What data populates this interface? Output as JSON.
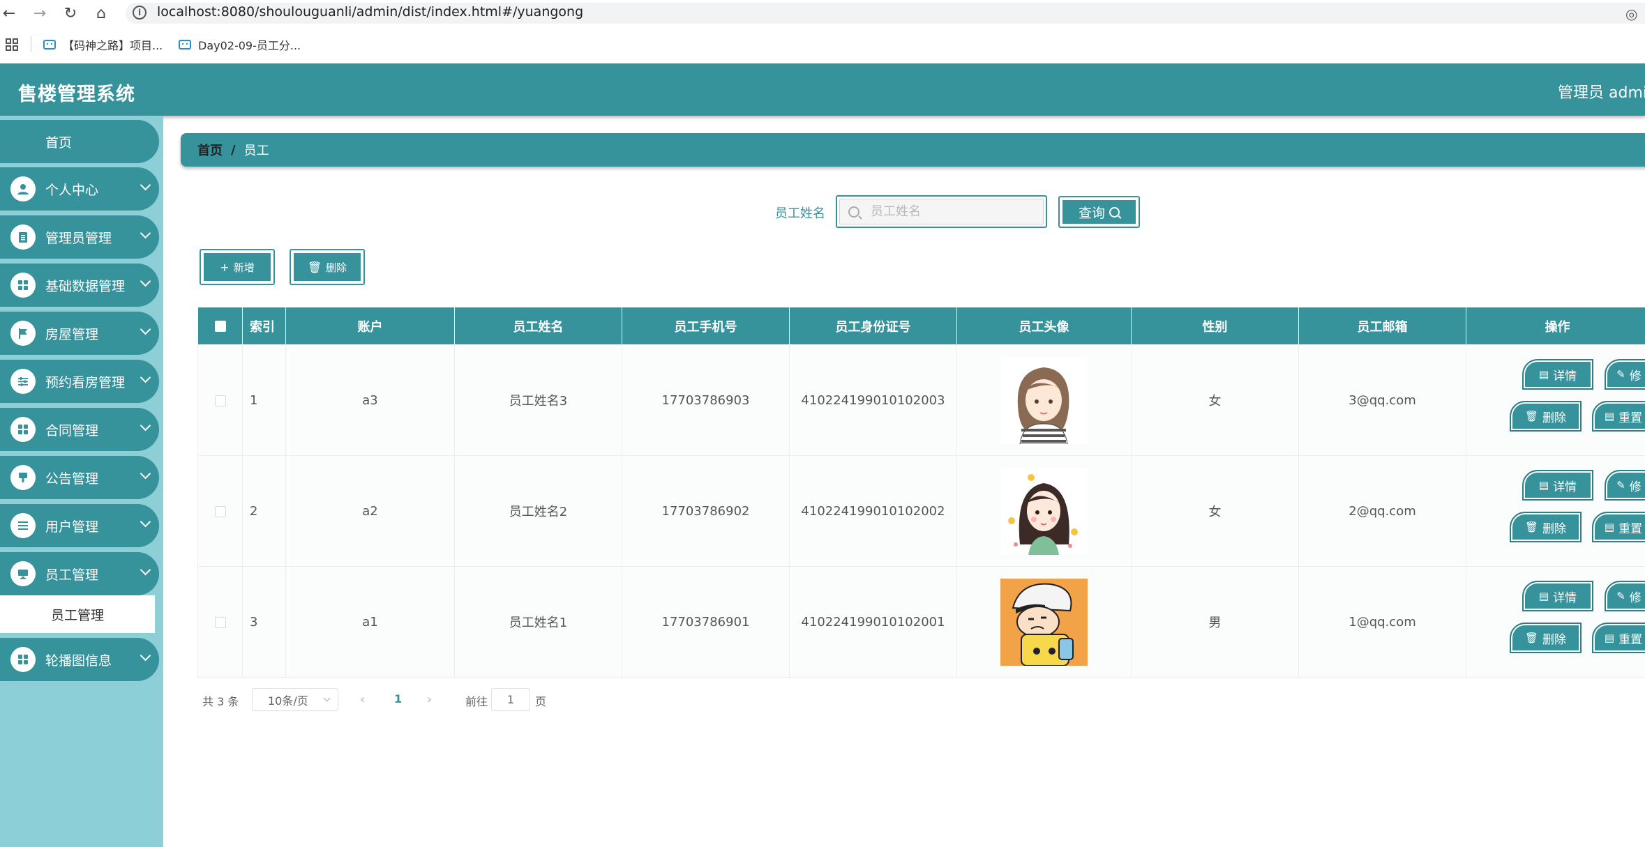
{
  "browser": {
    "url": "localhost:8080/shoulouguanli/admin/dist/index.html#/yuangong",
    "bookmarks": [
      "【码神之路】项目...",
      "Day02-09-员工分..."
    ]
  },
  "header": {
    "title": "售楼管理系统",
    "user": "管理员 admin"
  },
  "sidebar": {
    "home": "首页",
    "items": [
      {
        "label": "个人中心"
      },
      {
        "label": "管理员管理"
      },
      {
        "label": "基础数据管理"
      },
      {
        "label": "房屋管理"
      },
      {
        "label": "预约看房管理"
      },
      {
        "label": "合同管理"
      },
      {
        "label": "公告管理"
      },
      {
        "label": "用户管理"
      },
      {
        "label": "员工管理"
      },
      {
        "label": "轮播图信息"
      }
    ],
    "sub_item": "员工管理"
  },
  "breadcrumb": {
    "home": "首页",
    "sep": "/",
    "current": "员工"
  },
  "search": {
    "label": "员工姓名",
    "placeholder": "员工姓名",
    "button": "查询"
  },
  "actions": {
    "add": "新增",
    "delete": "删除"
  },
  "table": {
    "headers": [
      "索引",
      "账户",
      "员工姓名",
      "员工手机号",
      "员工身份证号",
      "员工头像",
      "性别",
      "员工邮箱",
      "操作"
    ],
    "rows": [
      {
        "index": "1",
        "account": "a3",
        "name": "员工姓名3",
        "phone": "17703786903",
        "idcard": "410224199010102003",
        "gender": "女",
        "email": "3@qq.com"
      },
      {
        "index": "2",
        "account": "a2",
        "name": "员工姓名2",
        "phone": "17703786902",
        "idcard": "410224199010102002",
        "gender": "女",
        "email": "2@qq.com"
      },
      {
        "index": "3",
        "account": "a1",
        "name": "员工姓名1",
        "phone": "17703786901",
        "idcard": "410224199010102001",
        "gender": "男",
        "email": "1@qq.com"
      }
    ],
    "row_buttons": {
      "detail": "详情",
      "edit": "修",
      "delete": "删除",
      "reset": "重置"
    }
  },
  "pagination": {
    "total": "共 3 条",
    "page_size": "10条/页",
    "current": "1",
    "goto": "前往",
    "goto_value": "1",
    "page_suffix": "页"
  },
  "colors": {
    "primary": "#36929b",
    "sidebar_bg": "#8dcfd7"
  }
}
